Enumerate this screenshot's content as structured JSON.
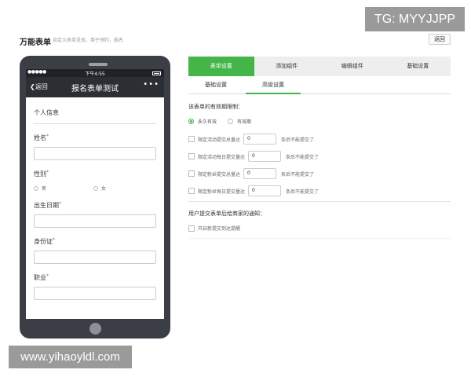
{
  "watermarks": {
    "tg": "TG: MYYJJPP",
    "site": "www.yihaoyldl.com"
  },
  "header": {
    "title": "万能表单",
    "subtitle": "自定义表单呈现，用于预约，报名",
    "back_label": "返回"
  },
  "phone": {
    "signal": "●●●●●",
    "time": "下午4:55",
    "nav_back": "返回",
    "nav_title": "报名表单测试",
    "nav_more": "•••",
    "section_title": "个人信息",
    "fields": {
      "name": "姓名",
      "gender": "性别",
      "birth": "出生日期",
      "id_card": "身份证",
      "job": "职业"
    },
    "required_mark": "*",
    "gender_options": [
      "男",
      "女"
    ]
  },
  "settings": {
    "tabs": [
      "表单设置",
      "添加组件",
      "编辑组件",
      "基础设置"
    ],
    "active_tab": 0,
    "subtabs": [
      "基础设置",
      "高级设置"
    ],
    "active_subtab": 1,
    "validity_label": "该表单的有效期限制：",
    "validity_options": [
      "永久有效",
      "有效期"
    ],
    "validity_selected": 0,
    "limits": [
      {
        "label": "限定活动提交总量达",
        "value": "0",
        "suffix": "条后不能提交了"
      },
      {
        "label": "限定活动每日提交量达",
        "value": "0",
        "suffix": "条后不能提交了"
      },
      {
        "label": "限定粉丝提交总量达",
        "value": "0",
        "suffix": "条后不能提交了"
      },
      {
        "label": "限定粉丝每日提交量达",
        "value": "0",
        "suffix": "条后不能提交了"
      }
    ],
    "notify_label": "用户提交表单后给商家的通知：",
    "notify_option": "开启新提交到达提醒"
  },
  "colors": {
    "accent": "#44b549",
    "phone_body": "#3b3f45"
  }
}
